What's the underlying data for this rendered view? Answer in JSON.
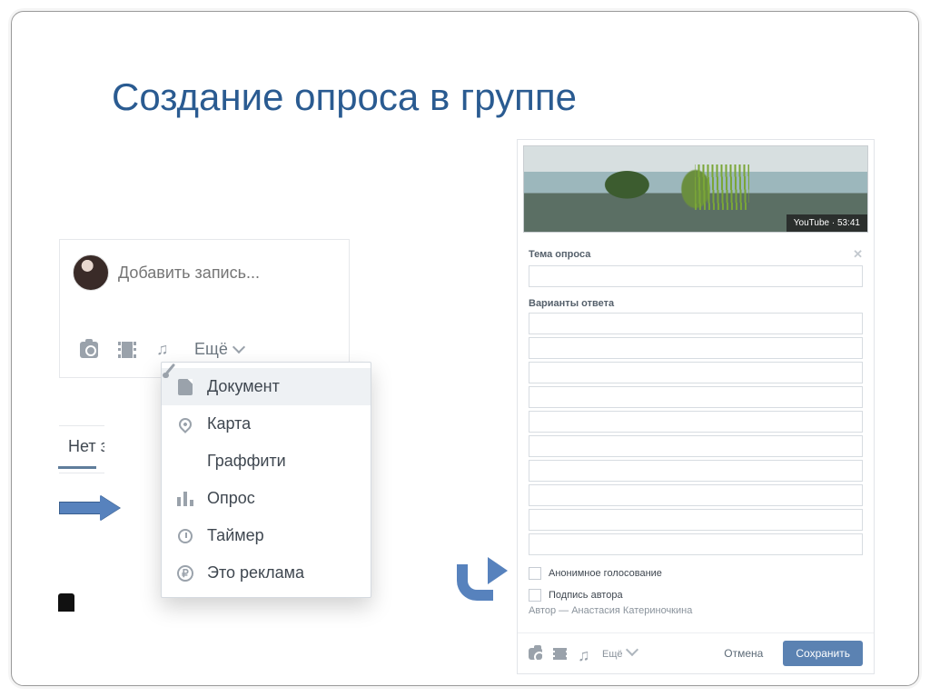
{
  "title": "Создание опроса в группе",
  "composer": {
    "placeholder": "Добавить запись...",
    "more_label": "Ещё"
  },
  "dropdown": {
    "items": [
      {
        "label": "Документ"
      },
      {
        "label": "Карта"
      },
      {
        "label": "Граффити"
      },
      {
        "label": "Опрос"
      },
      {
        "label": "Таймер"
      },
      {
        "label": "Это реклама"
      }
    ]
  },
  "fragment_text": "Нет з",
  "poll_form": {
    "video_badge": "YouTube · 53:41",
    "topic_label": "Тема опроса",
    "options_label": "Варианты ответа",
    "anonymous_label": "Анонимное голосование",
    "signature_label": "Подпись автора",
    "author_line": "Автор — Анастасия Катериночкина",
    "more_label": "Ещё",
    "cancel": "Отмена",
    "save": "Сохранить"
  }
}
